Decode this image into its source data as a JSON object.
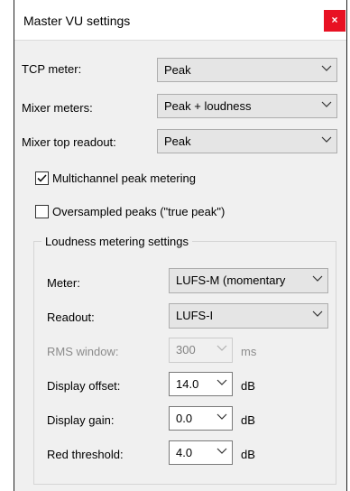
{
  "window": {
    "title": "Master VU settings",
    "close_glyph": "×"
  },
  "settings": {
    "tcp_meter": {
      "label": "TCP meter:",
      "value": "Peak"
    },
    "mixer_meters": {
      "label": "Mixer meters:",
      "value": "Peak + loudness"
    },
    "mixer_top_readout": {
      "label": "Mixer top readout:",
      "value": "Peak"
    },
    "multichannel": {
      "label": "Multichannel peak metering",
      "checked": true
    },
    "oversampled": {
      "label": "Oversampled peaks (\"true peak\")",
      "checked": false
    }
  },
  "loudness": {
    "group_title": "Loudness metering settings",
    "meter": {
      "label": "Meter:",
      "value": "LUFS-M (momentary"
    },
    "readout": {
      "label": "Readout:",
      "value": "LUFS-I"
    },
    "rms_window": {
      "label": "RMS window:",
      "value": "300",
      "unit": "ms",
      "enabled": false
    },
    "display_offset": {
      "label": "Display offset:",
      "value": "14.0",
      "unit": "dB"
    },
    "display_gain": {
      "label": "Display gain:",
      "value": "0.0",
      "unit": "dB"
    },
    "red_threshold": {
      "label": "Red threshold:",
      "value": "4.0",
      "unit": "dB"
    }
  },
  "colors": {
    "close_bg": "#e81123",
    "dialog_bg": "#f0f0f0",
    "combo_bg": "#e5e5e5"
  }
}
